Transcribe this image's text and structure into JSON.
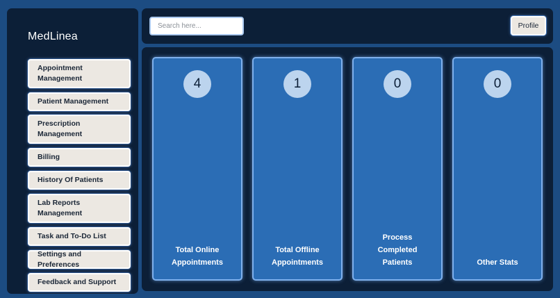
{
  "brand": {
    "name": "MedLinea"
  },
  "sidebar": {
    "items": [
      {
        "label": "Appointment Management"
      },
      {
        "label": "Patient Management"
      },
      {
        "label": "Prescription Management"
      },
      {
        "label": "Billing"
      },
      {
        "label": "History Of Patients"
      },
      {
        "label": "Lab Reports Management"
      },
      {
        "label": "Task and To-Do List"
      },
      {
        "label": "Settings and Preferences"
      },
      {
        "label": "Feedback and Support"
      }
    ]
  },
  "header": {
    "search_placeholder": "Search here...",
    "profile_label": "Profile"
  },
  "stats": [
    {
      "value": "4",
      "label": "Total Online Appointments"
    },
    {
      "value": "1",
      "label": "Total Offline Appointments"
    },
    {
      "value": "0",
      "label": "Process Completed Patients"
    },
    {
      "value": "0",
      "label": "Other Stats"
    }
  ],
  "colors": {
    "page_bg": "#1c4c82",
    "panel_bg": "#0c1f37",
    "card_bg": "#2b6db5",
    "button_bg": "#ece8e2",
    "circle_bg": "#bcd4ee"
  }
}
